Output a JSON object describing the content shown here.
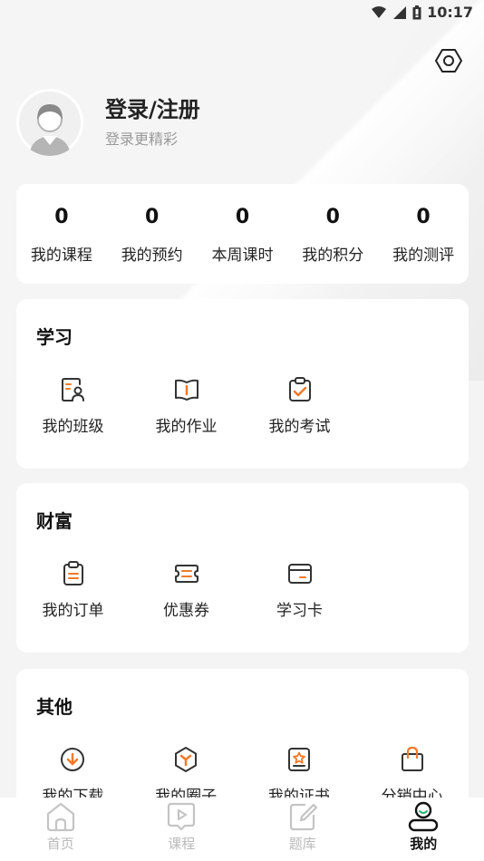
{
  "status_bar": {
    "time": "10:17"
  },
  "profile": {
    "title": "登录/注册",
    "subtitle": "登录更精彩"
  },
  "stats": [
    {
      "value": "0",
      "label": "我的课程"
    },
    {
      "value": "0",
      "label": "我的预约"
    },
    {
      "value": "0",
      "label": "本周课时"
    },
    {
      "value": "0",
      "label": "我的积分"
    },
    {
      "value": "0",
      "label": "我的测评"
    }
  ],
  "sections": {
    "study": {
      "title": "学习",
      "items": [
        {
          "label": "我的班级",
          "icon": "class-icon"
        },
        {
          "label": "我的作业",
          "icon": "homework-icon"
        },
        {
          "label": "我的考试",
          "icon": "exam-icon"
        }
      ]
    },
    "wealth": {
      "title": "财富",
      "items": [
        {
          "label": "我的订单",
          "icon": "order-icon"
        },
        {
          "label": "优惠券",
          "icon": "coupon-icon"
        },
        {
          "label": "学习卡",
          "icon": "study-card-icon"
        }
      ]
    },
    "other": {
      "title": "其他",
      "items": [
        {
          "label": "我的下载",
          "icon": "download-icon"
        },
        {
          "label": "我的圈子",
          "icon": "circle-icon"
        },
        {
          "label": "我的证书",
          "icon": "certificate-icon"
        },
        {
          "label": "分销中心",
          "icon": "distribution-icon"
        }
      ]
    }
  },
  "tabs": [
    {
      "label": "首页",
      "icon": "home-icon"
    },
    {
      "label": "课程",
      "icon": "course-icon"
    },
    {
      "label": "题库",
      "icon": "question-bank-icon"
    },
    {
      "label": "我的",
      "icon": "profile-icon"
    }
  ],
  "colors": {
    "accent": "#f07a2a",
    "icon_dark": "#333333",
    "tab_inactive": "#b9b9b9",
    "background": "#f4f4f4"
  }
}
